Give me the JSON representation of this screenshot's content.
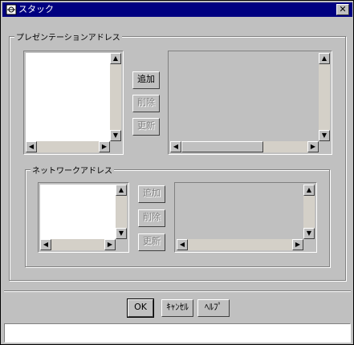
{
  "window": {
    "title": "スタック",
    "close_glyph": "✕"
  },
  "presentation_group": {
    "label": "プレゼンテーションアドレス",
    "buttons": {
      "add": "追加",
      "delete": "削除",
      "update": "更新"
    },
    "scroll_glyphs": {
      "up": "▲",
      "down": "▼",
      "left": "◀",
      "right": "▶"
    }
  },
  "network_group": {
    "label": "ネットワークアドレス",
    "buttons": {
      "add": "追加",
      "delete": "削除",
      "update": "更新"
    }
  },
  "footer": {
    "ok": "OK",
    "cancel": "ｷｬﾝｾﾙ",
    "help": "ﾍﾙﾌﾟ"
  },
  "status_bar": {
    "text": ""
  }
}
